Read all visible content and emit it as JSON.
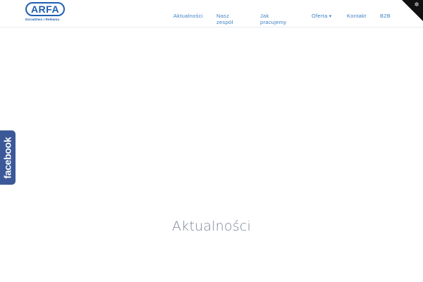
{
  "logo": {
    "text": "ARFA",
    "subtitle": "Doradztwo i Reklama"
  },
  "nav": {
    "items": [
      {
        "line1": "Aktualności",
        "line2": ""
      },
      {
        "line1": "Nasz",
        "line2": "zespół"
      },
      {
        "line1": "Jak",
        "line2": "pracujemy"
      },
      {
        "line1": "Oferta",
        "line2": "",
        "has_dropdown": true
      },
      {
        "line1": "Kontakt",
        "line2": ""
      },
      {
        "line1": "B2B",
        "line2": ""
      }
    ],
    "dropdown_glyph": "▾"
  },
  "corner": {
    "icon": "gear-icon",
    "glyph": "✲"
  },
  "facebook_tab": {
    "label": "facebook"
  },
  "page_title": "Aktualności",
  "colors": {
    "brand": "#1f5fb0",
    "nav_link": "#3b7fc4",
    "facebook": "#3b5998",
    "title": "#7a8594"
  }
}
